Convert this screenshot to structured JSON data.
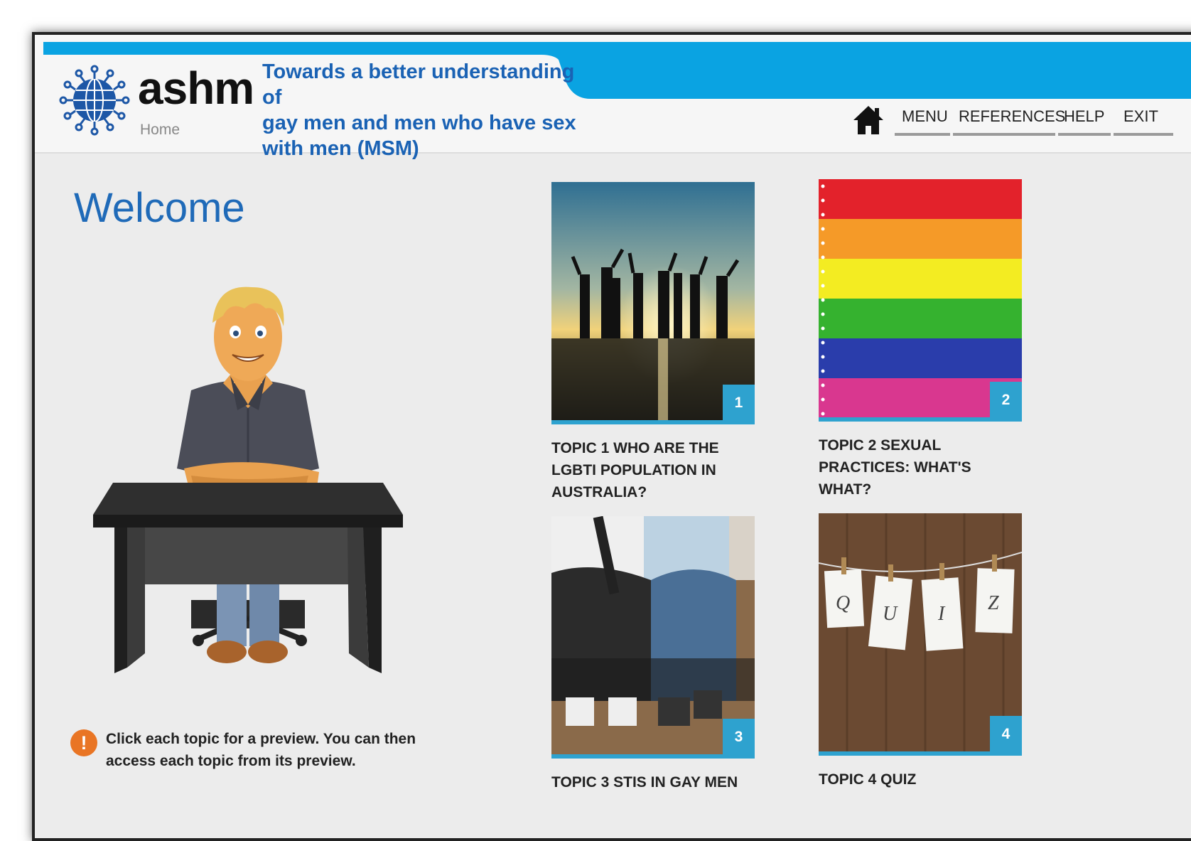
{
  "header": {
    "brand": "ashm",
    "home_label": "Home",
    "tagline": [
      "Towards a better understanding of",
      "gay men and men who have sex",
      "with men (MSM)"
    ],
    "logo_icon": "globe-logo-icon",
    "nav": [
      {
        "label": "MENU"
      },
      {
        "label": "REFERENCES"
      },
      {
        "label": "HELP"
      },
      {
        "label": "EXIT"
      }
    ],
    "home_icon": "house-icon",
    "accent_color": "#0aa3e2"
  },
  "main": {
    "title": "Welcome",
    "notice_icon": "exclamation-icon",
    "notice_text": [
      "Click each topic for a preview. You can then",
      "access each topic from its preview."
    ]
  },
  "topics": [
    {
      "number": "1",
      "label": [
        "TOPIC 1 WHO ARE THE",
        "LGBTI POPULATION IN",
        "AUSTRALIA?"
      ]
    },
    {
      "number": "2",
      "label": [
        "TOPIC 2 SEXUAL",
        "PRACTICES: WHAT'S",
        "WHAT?"
      ]
    },
    {
      "number": "3",
      "label": [
        "TOPIC 3 STIS IN GAY MEN"
      ]
    },
    {
      "number": "4",
      "label": [
        "TOPIC 4 QUIZ"
      ]
    }
  ],
  "quiz_letters": [
    "Q",
    "U",
    "I",
    "Z"
  ],
  "colors": {
    "title_blue": "#1f6ab8",
    "tile_accent": "#2ea2cf",
    "notice_orange": "#e97524"
  }
}
